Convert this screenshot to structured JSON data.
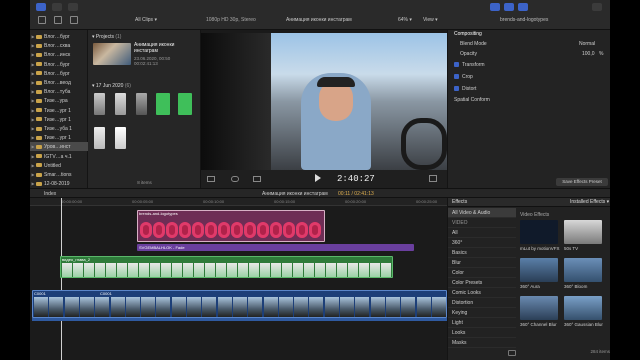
{
  "toolbar": {
    "library_filter": "All Clips",
    "format": "1080p HD 30p, Stereo",
    "project_title": "Анимация иконки инстаграм",
    "zoom": "64%",
    "view_menu": "View",
    "inspector_title": "brends-and-logotypes"
  },
  "sidebar": {
    "items": [
      {
        "label": "Влог…бург"
      },
      {
        "label": "Влог…схва"
      },
      {
        "label": "Влог…инск"
      },
      {
        "label": "Влог…бург"
      },
      {
        "label": "Влог…бург"
      },
      {
        "label": "Влог…веод"
      },
      {
        "label": "Влог…туба"
      },
      {
        "label": "Тизе…ура"
      },
      {
        "label": "Тизе…ург 1"
      },
      {
        "label": "Тизе…ург 1"
      },
      {
        "label": "Тизе…уба 1"
      },
      {
        "label": "Тизе…ург 1"
      },
      {
        "label": "Уров…инст"
      },
      {
        "label": "IGTV…a ч.1"
      },
      {
        "label": "Untitled"
      },
      {
        "label": "Smar…tions"
      },
      {
        "label": "12-08-2019"
      }
    ]
  },
  "browser": {
    "projects_label": "Projects",
    "projects_count": "(1)",
    "project_name": "Анимация иконки инстаграм",
    "project_date": "23.06.2020, 00:50",
    "project_duration": "00:02:41:13",
    "date_label": "17 Jun 2020",
    "date_count": "(6)",
    "items_count": "8 items"
  },
  "viewer": {
    "timecode": "2:40:27"
  },
  "inspector": {
    "compositing": "Compositing",
    "blend_mode_label": "Blend Mode",
    "blend_mode_value": "Normal",
    "opacity_label": "Opacity",
    "opacity_value": "100,0",
    "opacity_unit": "%",
    "transform": "Transform",
    "crop": "Crop",
    "distort": "Distort",
    "spatial_conform": "Spatial Conform",
    "save_preset": "Save Effects Preset"
  },
  "timeline_header": {
    "index_label": "Index",
    "project_title": "Анимация иконки инстаграм",
    "position": "00:11 / 02:41:13"
  },
  "timeline": {
    "ruler": [
      "00:00:00:00",
      "00:00:05:00",
      "00:00:10:00",
      "00:00:15:00",
      "00:00:20:00",
      "00:00:25:00"
    ],
    "clip_logos": "brends-and-logotypes",
    "clip_title": "SVGEMBALHLOK - Fade",
    "clip_video2": "видео_глава_2",
    "clip_c0001a": "C0001",
    "clip_c0001b": "C0001"
  },
  "effects": {
    "header": "Effects",
    "installed": "Installed Effects",
    "video_effects": "Video Effects",
    "categories": [
      "All Video & Audio",
      "VIDEO",
      "All",
      "360°",
      "Basics",
      "Blur",
      "Color",
      "Color Presets",
      "Comic Looks",
      "Distortion",
      "Keying",
      "Light",
      "Looks",
      "Masks"
    ],
    "tiles": [
      "mLut by motionVFX",
      "50s TV",
      "360° Aura",
      "360° Bloom",
      "360° Channel Blur",
      "360° Gaussian Blur"
    ],
    "count": "284 items"
  }
}
